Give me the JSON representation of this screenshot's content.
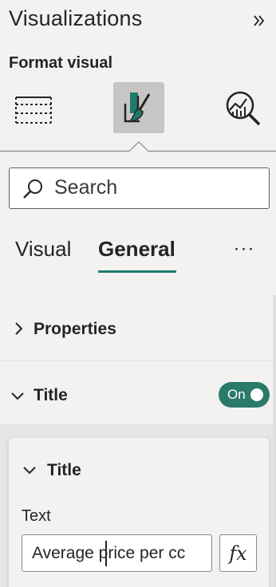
{
  "pane": {
    "title": "Visualizations",
    "subtitle": "Format visual",
    "icons": [
      "build-visual-icon",
      "format-visual-icon",
      "analytics-icon",
      "collapse-pane-icon"
    ]
  },
  "search": {
    "placeholder": "Search",
    "value": ""
  },
  "tabs": [
    {
      "label": "Visual",
      "selected": false
    },
    {
      "label": "General",
      "selected": true
    }
  ],
  "more_label": "···",
  "sections": [
    {
      "label": "Properties",
      "expanded": false
    },
    {
      "label": "Title",
      "expanded": true,
      "toggle_label": "On",
      "toggle_on": true
    }
  ],
  "title_card": {
    "label": "Title",
    "expanded": true,
    "text_field_label": "Text",
    "text_field_value": "Average price per cc",
    "fx_label": "fx"
  },
  "colors": {
    "accent": "#1f7a6d",
    "toggle_on": "#2a7a6a",
    "background": "#f3f2f1",
    "selected_icon_bg": "#c8c6c4"
  }
}
